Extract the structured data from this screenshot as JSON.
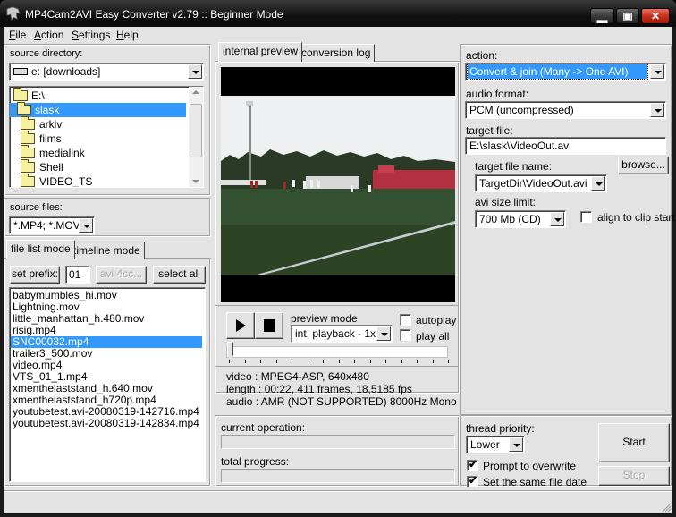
{
  "window": {
    "title": "MP4Cam2AVI Easy Converter v2.79 :: Beginner Mode",
    "buttons": {
      "minimize": "—",
      "maximize": "▢",
      "close": "✕"
    }
  },
  "menu": [
    {
      "label": "File",
      "accel": "F",
      "rest": "ile"
    },
    {
      "label": "Action",
      "accel": "A",
      "rest": "ction"
    },
    {
      "label": "Settings",
      "accel": "S",
      "rest": "ettings"
    },
    {
      "label": "Help",
      "accel": "H",
      "rest": "elp"
    }
  ],
  "source_directory": {
    "label": "source directory:",
    "drive": "e: [downloads]",
    "tree": [
      {
        "name": "E:\\",
        "level": 0,
        "open": true
      },
      {
        "name": "slask",
        "level": 1,
        "open": true,
        "selected": true
      },
      {
        "name": "arkiv",
        "level": 2
      },
      {
        "name": "films",
        "level": 2
      },
      {
        "name": "medialink",
        "level": 2
      },
      {
        "name": "Shell",
        "level": 2
      },
      {
        "name": "VIDEO_TS",
        "level": 2
      }
    ]
  },
  "source_files": {
    "label": "source files:",
    "filter": "*.MP4; *.MOV"
  },
  "left_tabs": [
    {
      "label": "file list mode",
      "active": true
    },
    {
      "label": "timeline mode",
      "active": false
    }
  ],
  "file_toolbar": {
    "set_prefix": "set prefix:",
    "prefix_value": "01",
    "avi4cc": "avi 4cc...",
    "select_all": "select all"
  },
  "files": [
    {
      "name": "babymumbles_hi.mov"
    },
    {
      "name": "Lightning.mov"
    },
    {
      "name": "little_manhattan_h.480.mov"
    },
    {
      "name": "risig.mp4"
    },
    {
      "name": "SNC00032.mp4",
      "selected": true
    },
    {
      "name": "trailer3_500.mov"
    },
    {
      "name": "video.mp4"
    },
    {
      "name": "VTS_01_1.mp4"
    },
    {
      "name": "xmenthelaststand_h.640.mov"
    },
    {
      "name": "xmenthelaststand_h720p.mp4"
    },
    {
      "name": "youtubetest.avi-20080319-142716.mp4"
    },
    {
      "name": "youtubetest.avi-20080319-142834.mp4"
    }
  ],
  "center_tabs": [
    {
      "label": "internal preview",
      "active": true
    },
    {
      "label": "conversion log",
      "active": false
    }
  ],
  "preview": {
    "play_icon": "▶",
    "stop_icon": "■",
    "mode_label": "preview mode",
    "mode_value": "int. playback - 1x",
    "autoplay": {
      "label": "autoplay",
      "checked": false
    },
    "play_all": {
      "label": "play all",
      "checked": false
    },
    "position": 0
  },
  "media_info": {
    "video": "video  : MPEG4-ASP, 640x480",
    "length": "length : 00:22, 411 frames, 18,5185 fps",
    "audio": "audio  : AMR (NOT SUPPORTED) 8000Hz Mono"
  },
  "progress": {
    "current_label": "current operation:",
    "current_value": 0,
    "total_label": "total progress:",
    "total_value": 0
  },
  "settings": {
    "action_label": "action:",
    "action_value": "Convert & join (Many -> One AVI)",
    "audio_label": "audio format:",
    "audio_value": "PCM (uncompressed)",
    "target_file_label": "target file:",
    "target_file_value": "E:\\slask\\VideoOut.avi",
    "target_name_label": "target file name:",
    "browse": "browse...",
    "target_name_value": "TargetDir\\VideoOut.avi",
    "size_limit_label": "avi size limit:",
    "size_limit_value": "700 Mb (CD)",
    "align_label": "align to clip start",
    "align_checked": false
  },
  "run": {
    "thread_label": "thread priority:",
    "thread_value": "Lower",
    "prompt_overwrite": {
      "label": "Prompt to overwrite",
      "checked": true
    },
    "same_date": {
      "label": "Set the same file date",
      "checked": true
    },
    "start": "Start",
    "stop": "Stop"
  },
  "colors": {
    "selection": "#3399ff",
    "face": "#e3e3e3"
  }
}
